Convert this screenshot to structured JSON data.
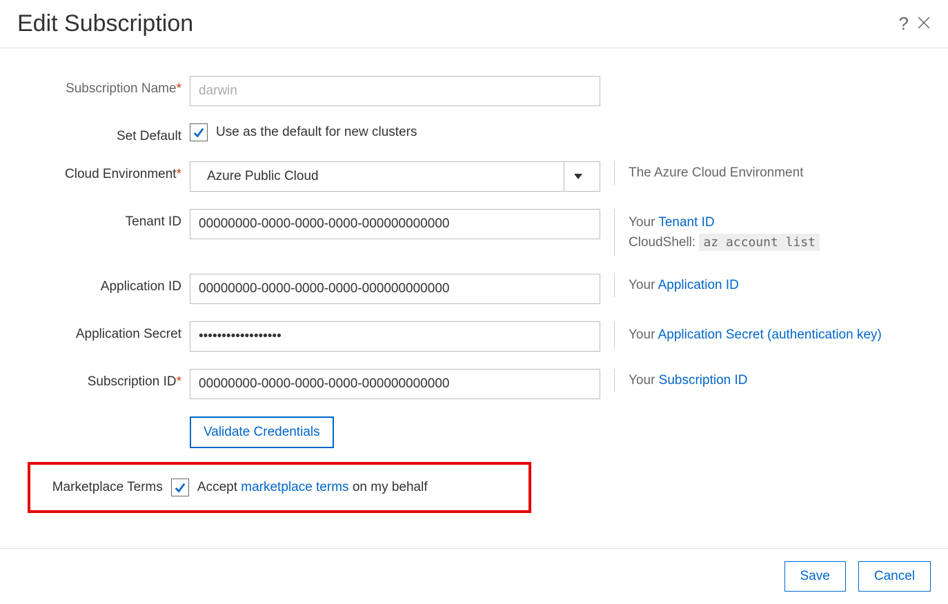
{
  "header": {
    "title": "Edit Subscription"
  },
  "fields": {
    "subscription_name": {
      "label": "Subscription Name",
      "required": true,
      "placeholder": "darwin"
    },
    "set_default": {
      "label": "Set Default",
      "checked": true,
      "text": "Use as the default for new clusters"
    },
    "cloud_env": {
      "label": "Cloud Environment",
      "required": true,
      "value": "Azure Public Cloud",
      "hint_prefix": "The Azure Cloud Environment"
    },
    "tenant_id": {
      "label": "Tenant ID",
      "value": "00000000-0000-0000-0000-000000000000",
      "hint_prefix": "Your ",
      "hint_link": "Tenant ID",
      "hint_line2_prefix": "CloudShell: ",
      "hint_line2_code": "az account list"
    },
    "application_id": {
      "label": "Application ID",
      "value": "00000000-0000-0000-0000-000000000000",
      "hint_prefix": "Your ",
      "hint_link": "Application ID"
    },
    "application_secret": {
      "label": "Application Secret",
      "value": "••••••••••••••••••",
      "hint_prefix": "Your ",
      "hint_link": "Application Secret (authentication key)"
    },
    "subscription_id": {
      "label": "Subscription ID",
      "required": true,
      "value": "00000000-0000-0000-0000-000000000000",
      "hint_prefix": "Your ",
      "hint_link": "Subscription ID"
    },
    "validate_button": "Validate Credentials",
    "marketplace_terms": {
      "label": "Marketplace Terms",
      "checked": true,
      "text_before": "Accept ",
      "link": "marketplace terms",
      "text_after": " on my behalf"
    }
  },
  "footer": {
    "save": "Save",
    "cancel": "Cancel"
  }
}
